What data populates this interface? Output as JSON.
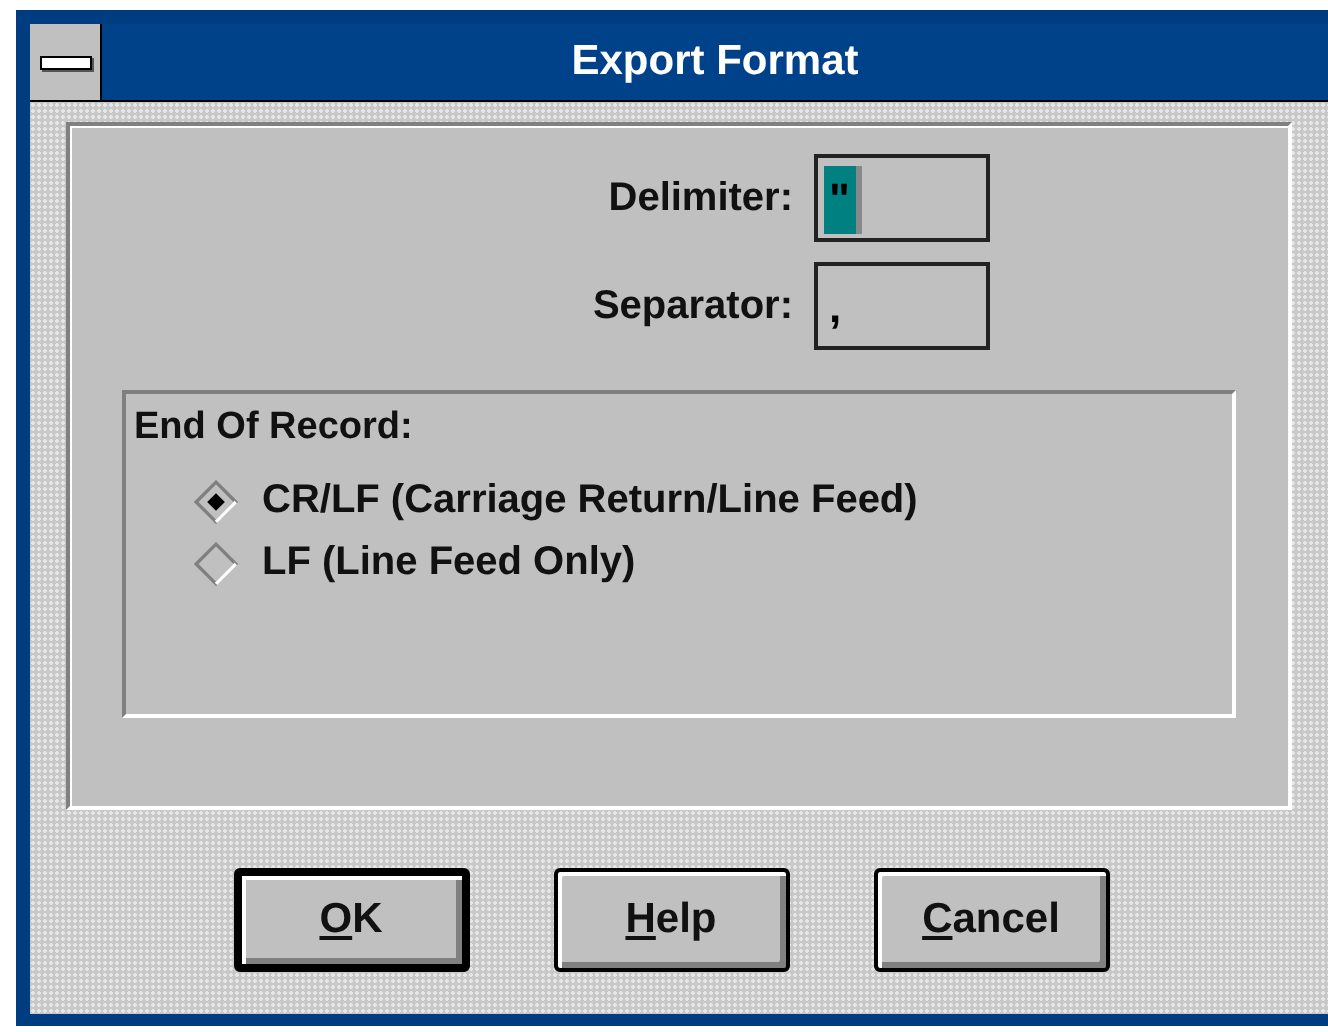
{
  "window": {
    "title": "Export Format"
  },
  "fields": [
    {
      "label": "Delimiter:",
      "value": "\"",
      "highlighted": true
    },
    {
      "label": "Separator:",
      "value": ",",
      "highlighted": false
    }
  ],
  "end_of_record": {
    "label": "End Of Record:",
    "options": [
      {
        "label": "CR/LF (Carriage Return/Line Feed)",
        "selected": true
      },
      {
        "label": "LF (Line Feed Only)",
        "selected": false
      }
    ]
  },
  "buttons": [
    {
      "label": "OK",
      "default": true
    },
    {
      "label": "Help",
      "default": false
    },
    {
      "label": "Cancel",
      "default": false
    }
  ]
}
